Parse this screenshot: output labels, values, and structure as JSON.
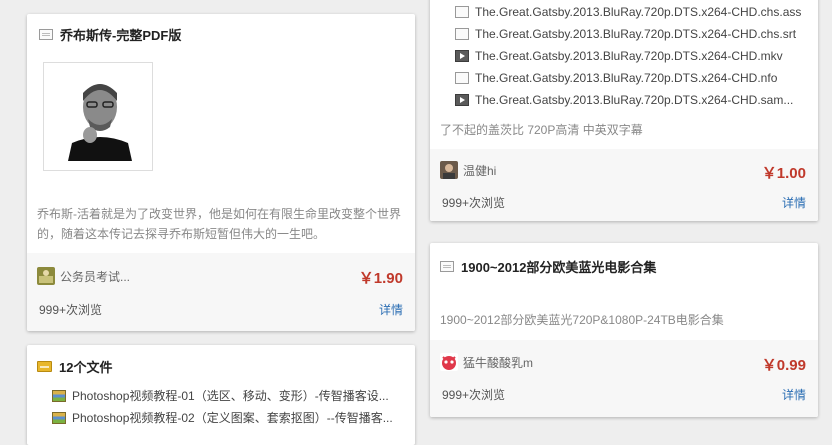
{
  "cards": {
    "jobs": {
      "title": "乔布斯传-完整PDF版",
      "image_alt": "乔布斯",
      "desc_line1": "乔布斯-活着就是为了改变世界，他是如何在有限生命里改变整个世界",
      "desc_line2": "的，随着这本传记去探寻乔布斯短暂但伟大的一生吧。",
      "author": "公务员考试...",
      "price": "￥1.90",
      "views": "999+次浏览",
      "detail": "详情"
    },
    "files12": {
      "title": "12个文件",
      "files": [
        "Photoshop视频教程-01（选区、移动、变形）-传智播客设...",
        "Photoshop视频教程-02（定义图案、套索抠图）--传智播客..."
      ]
    },
    "gatsby": {
      "files": [
        "The.Great.Gatsby.2013.BluRay.720p.DTS.x264-CHD.chs.ass",
        "The.Great.Gatsby.2013.BluRay.720p.DTS.x264-CHD.chs.srt",
        "The.Great.Gatsby.2013.BluRay.720p.DTS.x264-CHD.mkv",
        "The.Great.Gatsby.2013.BluRay.720p.DTS.x264-CHD.nfo",
        "The.Great.Gatsby.2013.BluRay.720p.DTS.x264-CHD.sam..."
      ],
      "file_types": [
        "doc",
        "doc",
        "video",
        "doc",
        "video"
      ],
      "desc": "了不起的盖茨比 720P高清 中英双字幕",
      "author": "温健hi",
      "price": "￥1.00",
      "views": "999+次浏览",
      "detail": "详情"
    },
    "movies": {
      "title": "1900~2012部分欧美蓝光电影合集",
      "desc": "1900~2012部分欧美蓝光720P&1080P-24TB电影合集",
      "author": "猛牛酸酸乳m",
      "price": "￥0.99",
      "views": "999+次浏览",
      "detail": "详情"
    }
  },
  "colors": {
    "price": "#c0392b",
    "link": "#2a6db3",
    "background": "#eeeeee"
  }
}
